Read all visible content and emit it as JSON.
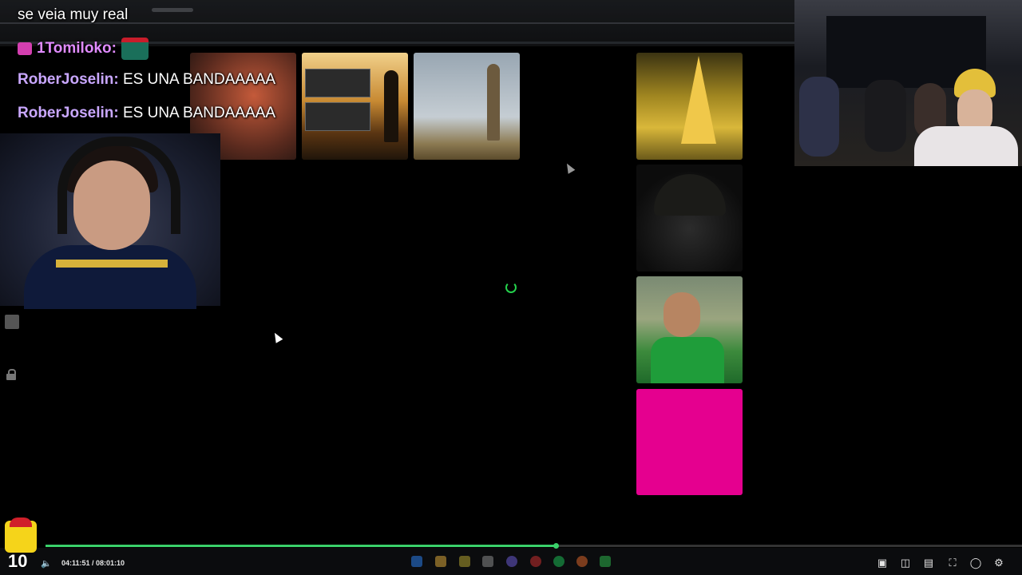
{
  "chat": {
    "line0": {
      "message": "se veia muy real"
    },
    "line1": {
      "user": "1Tomiloko:"
    },
    "line2": {
      "user": "RoberJoselin:",
      "message": "ES UNA BANDAAAAA"
    },
    "line3": {
      "user": "RoberJoselin:",
      "message": "ES UNA BANDAAAAA"
    }
  },
  "player": {
    "time_display": "04:11:51 / 08:01:10",
    "progress": 0.5228,
    "channel_badge": "10"
  },
  "colors": {
    "progress": "#3ad06a",
    "spinner": "#24d14c",
    "tile_pink": "#e5008f",
    "chat_username": "#c9a7ff"
  },
  "icons": [
    "volume-icon",
    "theater-mode-icon",
    "clip-icon",
    "miniplayer-icon",
    "fullscreen-icon",
    "playback-speed-icon",
    "settings-icon",
    "lock-icon",
    "chat-icon",
    "loading-spinner-icon"
  ]
}
